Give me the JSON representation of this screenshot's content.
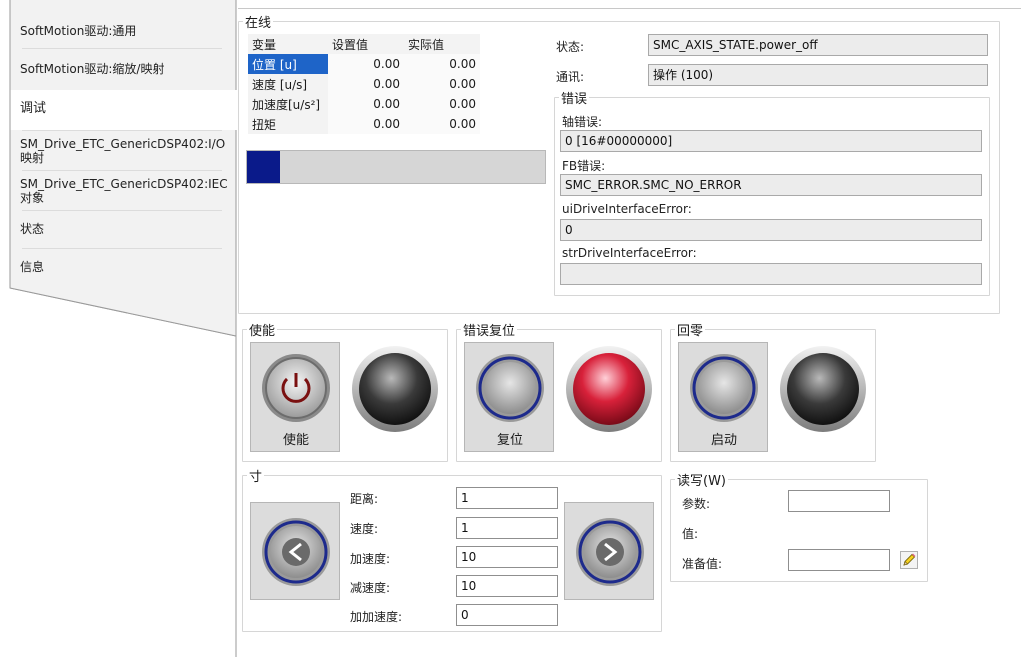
{
  "tabs": [
    {
      "label": "SoftMotion驱动:通用"
    },
    {
      "label": "SoftMotion驱动:缩放/映射"
    },
    {
      "label": "调试"
    },
    {
      "label": "SM_Drive_ETC_GenericDSP402:I/O\n映射"
    },
    {
      "label": "SM_Drive_ETC_GenericDSP402:IEC\n对象"
    },
    {
      "label": "状态"
    },
    {
      "label": "信息"
    }
  ],
  "online": {
    "title": "在线",
    "table": {
      "headers": [
        "变量",
        "设置值",
        "实际值"
      ],
      "rows": [
        {
          "name": "位置 [u]",
          "set": "0.00",
          "actual": "0.00",
          "selected": true
        },
        {
          "name": "速度 [u/s]",
          "set": "0.00",
          "actual": "0.00"
        },
        {
          "name": "加速度[u/s²]",
          "set": "0.00",
          "actual": "0.00"
        },
        {
          "name": "扭矩",
          "set": "0.00",
          "actual": "0.00"
        }
      ]
    },
    "progress_fraction": 0.11,
    "progress_color": "#0a1a8a",
    "status_label": "状态:",
    "status_value": "SMC_AXIS_STATE.power_off",
    "comm_label": "通讯:",
    "comm_value": "操作 (100)",
    "errors": {
      "title": "错误",
      "axis_error_label": "轴错误:",
      "axis_error_value": "0 [16#00000000]",
      "fb_error_label": "FB错误:",
      "fb_error_value": "SMC_ERROR.SMC_NO_ERROR",
      "ui_label": "uiDriveInterfaceError:",
      "ui_value": "0",
      "str_label": "strDriveInterfaceError:",
      "str_value": ""
    }
  },
  "enable": {
    "title": "使能",
    "button_label": "使能",
    "button_icon": "power-icon",
    "lamp_color": "#3a3a3a"
  },
  "reset": {
    "title": "错误复位",
    "button_label": "复位",
    "lamp_color": "#d8213a"
  },
  "homing": {
    "title": "回零",
    "button_label": "启动",
    "lamp_color": "#3a3a3a"
  },
  "jog": {
    "title": "寸",
    "fields": [
      {
        "label": "距离:",
        "value": "1"
      },
      {
        "label": "速度:",
        "value": "1"
      },
      {
        "label": "加速度:",
        "value": "10"
      },
      {
        "label": "减速度:",
        "value": "10"
      },
      {
        "label": "加加速度:",
        "value": "0"
      }
    ],
    "left_icon": "arrow-left-icon",
    "right_icon": "arrow-right-icon"
  },
  "rw": {
    "title": "读写(W)",
    "param_label": "参数:",
    "param_value": "",
    "value_label": "值:",
    "prepare_label": "准备值:",
    "prepare_value": ""
  }
}
